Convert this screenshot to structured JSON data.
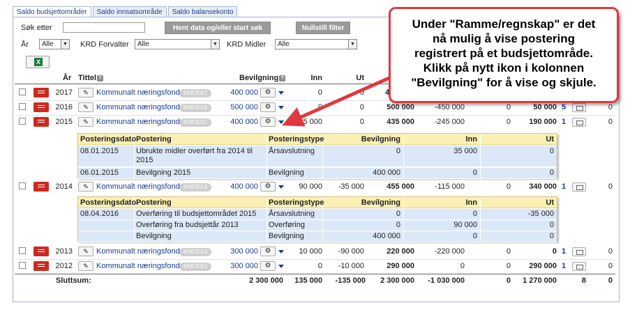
{
  "tabs": [
    "Saldo budsjettområder",
    "Saldo innsatsområde",
    "Saldo balansekonto"
  ],
  "filters": {
    "search_label": "Søk etter",
    "year_label": "År",
    "year_value": "Alle",
    "krd_forvalter_label": "KRD Forvalter",
    "krd_forvalter_value": "Alle",
    "krd_midler_label": "KRD Midler",
    "krd_midler_value": "Alle",
    "fetch_button": "Hent data og/eller start søk",
    "reset_button": "Nullstill filter"
  },
  "columns": {
    "year": "År",
    "title": "Tittel",
    "bevilgning": "Bevilgning",
    "inn": "Inn",
    "ut": "Ut"
  },
  "rows": [
    {
      "year": "2017",
      "title": "Kommunalt næringsfond",
      "code": "KNF2017",
      "bevilgning": "400 000",
      "inn": "0",
      "ut": "0",
      "col_a": "4",
      "col_b": "",
      "col_c": "",
      "col_d": "",
      "col_e": "",
      "col_f": ""
    },
    {
      "year": "2016",
      "title": "Kommunalt næringsfond",
      "code": "KNF2016",
      "bevilgning": "500 000",
      "inn": "0",
      "ut": "0",
      "col_a": "500 000",
      "col_b": "-450 000",
      "col_c": "0",
      "col_d": "50 000",
      "col_e": "5",
      "col_f": "0"
    },
    {
      "year": "2015",
      "title": "Kommunalt næringsfond",
      "code": "KNF2015",
      "bevilgning": "400 000",
      "inn": "35 000",
      "ut": "0",
      "col_a": "435 000",
      "col_b": "-245 000",
      "col_c": "0",
      "col_d": "190 000",
      "col_e": "1",
      "col_f": "0"
    },
    {
      "year": "2014",
      "title": "Kommunalt næringsfond",
      "code": "KNF2014",
      "bevilgning": "400 000",
      "inn": "90 000",
      "ut": "-35 000",
      "col_a": "455 000",
      "col_b": "-115 000",
      "col_c": "0",
      "col_d": "340 000",
      "col_e": "1",
      "col_f": "0"
    },
    {
      "year": "2013",
      "title": "Kommunalt næringsfond",
      "code": "KNF2013",
      "bevilgning": "300 000",
      "inn": "10 000",
      "ut": "-90 000",
      "col_a": "220 000",
      "col_b": "-220 000",
      "col_c": "0",
      "col_d": "0",
      "col_e": "1",
      "col_f": "0"
    },
    {
      "year": "2012",
      "title": "Kommunalt næringsfond",
      "code": "KNF2012",
      "bevilgning": "300 000",
      "inn": "0",
      "ut": "-10 000",
      "col_a": "290 000",
      "col_b": "0",
      "col_c": "0",
      "col_d": "290 000",
      "col_e": "1",
      "col_f": "0"
    }
  ],
  "sub_headers": {
    "date": "Posteringsdato",
    "posting": "Postering",
    "type": "Posteringstype",
    "bevilgning": "Bevilgning",
    "inn": "Inn",
    "ut": "Ut"
  },
  "sub_2015": [
    {
      "date": "08.01.2015",
      "posting_line1": "Ubrukte midler overført fra 2014 til",
      "posting_line2": "2015",
      "type": "Årsavslutning",
      "bevilgning": "0",
      "inn": "35 000",
      "ut": "0"
    },
    {
      "date": "06.01.2015",
      "posting_line1": "Bevilgning 2015",
      "posting_line2": "",
      "type": "Bevilgning",
      "bevilgning": "400 000",
      "inn": "0",
      "ut": "0"
    }
  ],
  "sub_2014": [
    {
      "date": "08.04.2016",
      "posting": "Overføring til budsjettområdet 2015",
      "type": "Årsavslutning",
      "bevilgning": "0",
      "inn": "0",
      "ut": "-35 000"
    },
    {
      "date": "",
      "posting": "Overføring fra budsjettår 2013",
      "type": "Overføring",
      "bevilgning": "0",
      "inn": "90 000",
      "ut": "0"
    },
    {
      "date": "",
      "posting": "Bevilgning",
      "type": "Bevilgning",
      "bevilgning": "400 000",
      "inn": "0",
      "ut": "0"
    }
  ],
  "totals": {
    "label": "Sluttsum:",
    "bevilgning": "2 300 000",
    "inn": "135 000",
    "ut": "-135 000",
    "col_a": "2 300 000",
    "col_b": "-1 030 000",
    "col_c": "0",
    "col_d": "1 270 000",
    "col_e": "8",
    "col_f": "0"
  },
  "callout": {
    "line1": "Under \"Ramme/regnskap\" er det",
    "line2": "nå mulig å vise postering",
    "line3": "registrert på et budsjettområde.",
    "line4": "Klikk på nytt ikon i kolonnen",
    "line5": "\"Bevilgning\" for å vise og skjule."
  },
  "colors": {
    "accent_red": "#cc2a1f",
    "callout_border": "#e0383f",
    "link_blue": "#1a3c8c"
  }
}
